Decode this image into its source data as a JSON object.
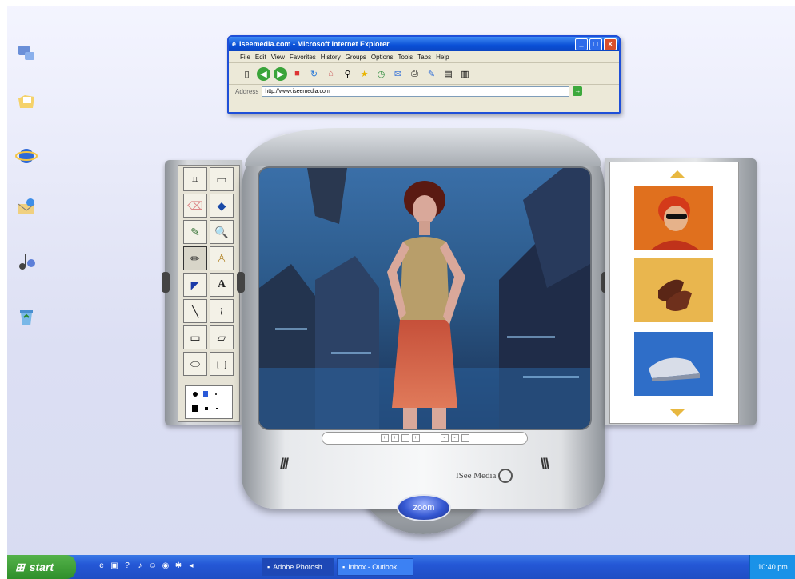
{
  "desktop": {
    "icons": [
      {
        "name": "my-computer-icon"
      },
      {
        "name": "my-documents-icon"
      },
      {
        "name": "internet-explorer-icon"
      },
      {
        "name": "outlook-express-icon"
      },
      {
        "name": "music-icon"
      },
      {
        "name": "recycle-bin-icon"
      }
    ]
  },
  "ie": {
    "title": "Iseemedia.com - Microsoft Internet Explorer",
    "menu": [
      "File",
      "Edit",
      "View",
      "Favorites",
      "History",
      "Groups",
      "Options",
      "Tools",
      "Tabs",
      "Help"
    ],
    "address_label": "Address",
    "address": "http://www.iseemedia.com",
    "btn_min": "_",
    "btn_max": "□",
    "btn_close": "×"
  },
  "viewer": {
    "brand": "ISee Media",
    "zoom_label": "zoom",
    "nav_controls": [
      "+",
      "+",
      "+",
      "+",
      "-",
      "-",
      "+"
    ]
  },
  "palette": {
    "tools": [
      "free-select",
      "rect-select",
      "eraser",
      "fill",
      "eyedropper",
      "magnifier",
      "pencil",
      "brush",
      "airbrush",
      "text",
      "line",
      "curve",
      "rectangle",
      "polygon",
      "ellipse",
      "rounded-rect"
    ],
    "glyphs": [
      "⌗",
      "▭",
      "⌫",
      "◆",
      "✎",
      "🔍",
      "✏",
      "♙",
      "◤",
      "A",
      "╲",
      "≀",
      "▭",
      "▱",
      "⬭",
      "▢"
    ]
  },
  "taskbar": {
    "start": "start",
    "tasks": [
      "Adobe Photosh",
      "Inbox - Outlook"
    ],
    "clock": "10:40 pm"
  },
  "colors": {
    "xp_blue": "#2457d6",
    "start_green": "#3f9f38",
    "accent_orange": "#e8b840"
  }
}
